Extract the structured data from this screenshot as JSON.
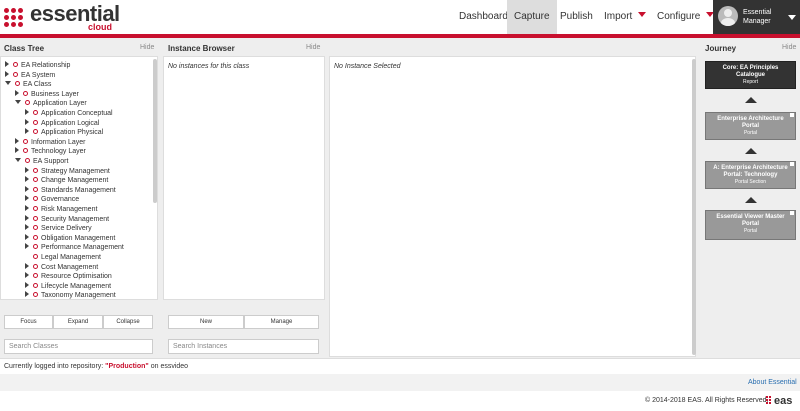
{
  "header": {
    "logo_text": "essential",
    "logo_sub": "cloud",
    "nav": [
      {
        "label": "Dashboard",
        "dropdown": false,
        "active": false
      },
      {
        "label": "Capture",
        "dropdown": false,
        "active": true
      },
      {
        "label": "Publish",
        "dropdown": false,
        "active": false
      },
      {
        "label": "Import",
        "dropdown": true,
        "active": false
      },
      {
        "label": "Configure",
        "dropdown": true,
        "active": false
      }
    ],
    "user": {
      "name_line1": "Essential",
      "name_line2": "Manager"
    }
  },
  "class_tree": {
    "title": "Class Tree",
    "hide_label": "Hide",
    "items": [
      {
        "label": "EA Relationship",
        "level": 0,
        "toggle": "closed"
      },
      {
        "label": "EA System",
        "level": 0,
        "toggle": "closed"
      },
      {
        "label": "EA Class",
        "level": 0,
        "toggle": "open"
      },
      {
        "label": "Business Layer",
        "level": 1,
        "toggle": "closed"
      },
      {
        "label": "Application Layer",
        "level": 1,
        "toggle": "open"
      },
      {
        "label": "Application Conceptual",
        "level": 2,
        "toggle": "closed"
      },
      {
        "label": "Application Logical",
        "level": 2,
        "toggle": "closed"
      },
      {
        "label": "Application Physical",
        "level": 2,
        "toggle": "closed"
      },
      {
        "label": "Information Layer",
        "level": 1,
        "toggle": "closed"
      },
      {
        "label": "Technology Layer",
        "level": 1,
        "toggle": "closed"
      },
      {
        "label": "EA Support",
        "level": 1,
        "toggle": "open"
      },
      {
        "label": "Strategy Management",
        "level": 2,
        "toggle": "closed"
      },
      {
        "label": "Change Management",
        "level": 2,
        "toggle": "closed"
      },
      {
        "label": "Standards Management",
        "level": 2,
        "toggle": "closed"
      },
      {
        "label": "Governance",
        "level": 2,
        "toggle": "closed"
      },
      {
        "label": "Risk Management",
        "level": 2,
        "toggle": "closed"
      },
      {
        "label": "Security Management",
        "level": 2,
        "toggle": "closed"
      },
      {
        "label": "Service Delivery",
        "level": 2,
        "toggle": "closed"
      },
      {
        "label": "Obligation Management",
        "level": 2,
        "toggle": "closed"
      },
      {
        "label": "Performance Management",
        "level": 2,
        "toggle": "closed"
      },
      {
        "label": "Legal Management",
        "level": 2,
        "toggle": "none"
      },
      {
        "label": "Cost Management",
        "level": 2,
        "toggle": "closed"
      },
      {
        "label": "Resource Optimisation",
        "level": 2,
        "toggle": "closed"
      },
      {
        "label": "Lifecycle Management",
        "level": 2,
        "toggle": "closed"
      },
      {
        "label": "Taxonomy Management",
        "level": 2,
        "toggle": "closed"
      }
    ],
    "buttons": {
      "focus": "Focus",
      "expand": "Expand",
      "collapse": "Collapse"
    },
    "search_placeholder": "Search Classes"
  },
  "instance_browser": {
    "title": "Instance Browser",
    "hide_label": "Hide",
    "empty_message": "No instances for this class",
    "buttons": {
      "new": "New",
      "manage": "Manage"
    },
    "search_placeholder": "Search Instances"
  },
  "instance_editor": {
    "empty_message": "No Instance Selected"
  },
  "journey": {
    "title": "Journey",
    "hide_label": "Hide",
    "cards": [
      {
        "title": "Core: EA Principles Catalogue",
        "subtitle": "Report",
        "current": true
      },
      {
        "title": "Enterprise Architecture Portal",
        "subtitle": "Portal",
        "current": false
      },
      {
        "title": "A: Enterprise Architecture Portal: Technology",
        "subtitle": "Portal Section",
        "current": false
      },
      {
        "title": "Essential Viewer Master Portal",
        "subtitle": "Portal",
        "current": false
      }
    ]
  },
  "footer": {
    "login_prefix": "Currently logged into repository: ",
    "repository": "\"Production\"",
    "login_suffix": " on essvideo",
    "about_link": "About Essential",
    "copyright": "© 2014-2018 EAS. All Rights Reserved.",
    "eas_logo": "eas"
  },
  "colors": {
    "accent": "#c8102e",
    "dark": "#333333"
  }
}
